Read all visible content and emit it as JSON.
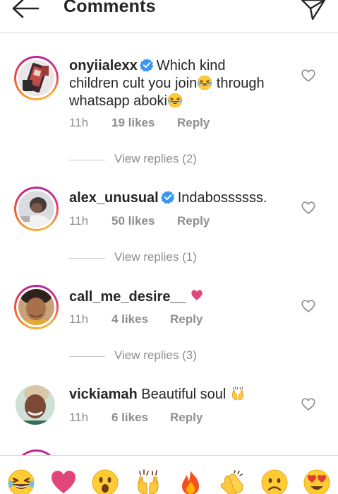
{
  "header": {
    "title": "Comments",
    "back_icon": "arrow-left-icon",
    "send_icon": "paper-plane-icon"
  },
  "comments": [
    {
      "username": "onyiialexx",
      "verified": true,
      "text_line1": "Which kind",
      "text_line2": "children cult you join",
      "text_line2b": " through",
      "text_line3": "whatsapp aboki",
      "time": "11h",
      "likes": "19 likes",
      "reply": "Reply",
      "view_replies": "View replies (2)"
    },
    {
      "username": "alex_unusual",
      "verified": true,
      "text": "Indabossssss.",
      "time": "11h",
      "likes": "50 likes",
      "reply": "Reply",
      "view_replies": "View replies (1)"
    },
    {
      "username": "call_me_desire__",
      "verified": false,
      "text": "",
      "time": "11h",
      "likes": "4 likes",
      "reply": "Reply",
      "view_replies": "View replies (3)"
    },
    {
      "username": "vickiamah",
      "verified": false,
      "text": "Beautiful soul",
      "time": "11h",
      "likes": "6 likes",
      "reply": "Reply"
    }
  ],
  "emoji_bar": [
    "grinning-squinting-face",
    "pink-heart",
    "face-with-open-mouth",
    "raising-hands",
    "fire",
    "clapping-hands",
    "frowning-face",
    "heart-eyes-face"
  ],
  "colors": {
    "text": "#262626",
    "secondary": "#8e8e8e",
    "verified_blue": "#3897f0",
    "divider": "#dbdbdb",
    "heart_pink": "#e0457b"
  }
}
